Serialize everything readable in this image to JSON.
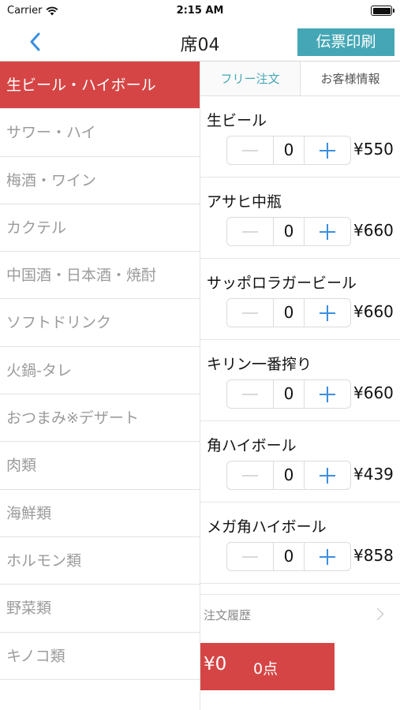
{
  "status_bar": {
    "carrier": "Carrier",
    "time": "2:15 AM"
  },
  "nav": {
    "title": "席04",
    "print_label": "伝票印刷"
  },
  "categories": [
    {
      "label": "生ビール・ハイボール",
      "active": true
    },
    {
      "label": "サワー・ハイ"
    },
    {
      "label": "梅酒・ワイン"
    },
    {
      "label": "カクテル"
    },
    {
      "label": "中国酒・日本酒・焼酎"
    },
    {
      "label": "ソフトドリンク"
    },
    {
      "label": "火鍋-タレ"
    },
    {
      "label": "おつまみ※デザート"
    },
    {
      "label": "肉類"
    },
    {
      "label": "海鮮類"
    },
    {
      "label": "ホルモン類"
    },
    {
      "label": "野菜類"
    },
    {
      "label": "キノコ類"
    }
  ],
  "tabs": {
    "free_order": "フリー注文",
    "customer_info": "お客様情報"
  },
  "products": [
    {
      "name": "生ビール",
      "qty": "0",
      "price": "¥550"
    },
    {
      "name": "アサヒ中瓶",
      "qty": "0",
      "price": "¥660"
    },
    {
      "name": "サッポロラガービール",
      "qty": "0",
      "price": "¥660"
    },
    {
      "name": "キリン一番搾り",
      "qty": "0",
      "price": "¥660"
    },
    {
      "name": "角ハイボール",
      "qty": "0",
      "price": "¥439"
    },
    {
      "name": "メガ角ハイボール",
      "qty": "0",
      "price": "¥858"
    }
  ],
  "history": {
    "label": "注文履歴"
  },
  "total": {
    "amount": "¥0",
    "count": "0点"
  },
  "colors": {
    "accent_red": "#d64545",
    "accent_teal": "#45a7b5",
    "stepper_blue": "#3b8ee0"
  }
}
